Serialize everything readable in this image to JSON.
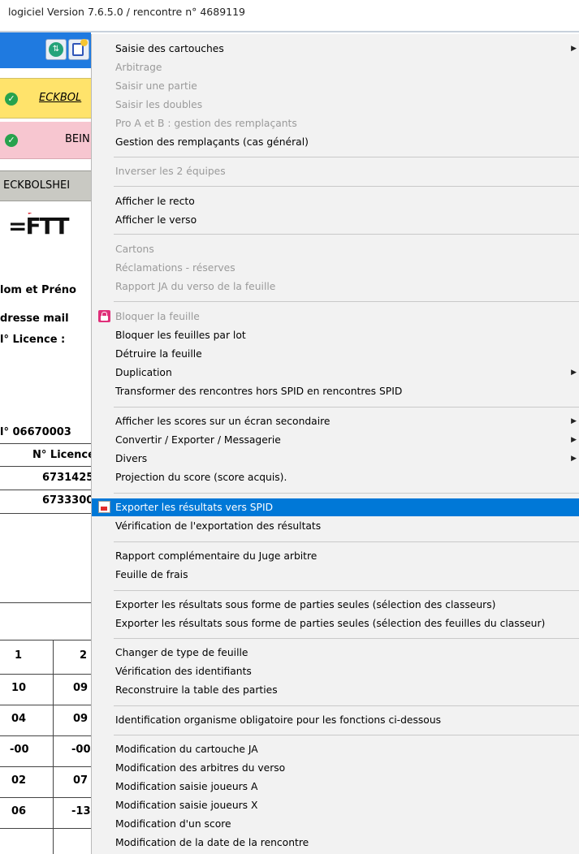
{
  "window": {
    "title": "logiciel Version 7.6.5.0  /  rencontre n° 4689119"
  },
  "background": {
    "team_a": "ECKBOL",
    "team_b": "BEIN",
    "team_row": "ECKBOLSHEI",
    "logo_text": "=FTT",
    "labels": {
      "nom_prenom": "lom et Préno",
      "adresse_mail": "dresse mail",
      "licence": "l° Licence   :"
    },
    "table": {
      "numero": "l° 06670003",
      "header": "N° Licence",
      "licences": [
        "6731425",
        "6733300"
      ]
    },
    "scores": {
      "headers": [
        "1",
        "2"
      ],
      "rows": [
        [
          "10",
          "09"
        ],
        [
          "04",
          "09"
        ],
        [
          "-00",
          "-00"
        ],
        [
          "02",
          "07"
        ],
        [
          "06",
          "-13"
        ]
      ]
    }
  },
  "menu": {
    "items": [
      {
        "label": "Saisie des cartouches",
        "disabled": false,
        "submenu": true
      },
      {
        "label": "Arbitrage",
        "disabled": true
      },
      {
        "label": "Saisir une partie",
        "disabled": true
      },
      {
        "label": "Saisir les doubles",
        "disabled": true
      },
      {
        "label": "Pro A et B : gestion des remplaçants",
        "disabled": true
      },
      {
        "label": "Gestion des remplaçants (cas général)",
        "disabled": false
      },
      {
        "label": "Inverser les 2 équipes",
        "disabled": true
      },
      {
        "label": "Afficher le recto",
        "disabled": false
      },
      {
        "label": "Afficher le verso",
        "disabled": false
      },
      {
        "label": "Cartons",
        "disabled": true
      },
      {
        "label": "Réclamations - réserves",
        "disabled": true
      },
      {
        "label": "Rapport JA du verso de la feuille",
        "disabled": true
      },
      {
        "label": "Bloquer la feuille",
        "disabled": true,
        "icon": "lock-icon"
      },
      {
        "label": "Bloquer les feuilles par lot",
        "disabled": false
      },
      {
        "label": "Détruire la feuille",
        "disabled": false
      },
      {
        "label": "Duplication",
        "disabled": false,
        "submenu": true
      },
      {
        "label": "Transformer des rencontres hors SPID en rencontres SPID",
        "disabled": false
      },
      {
        "label": "Afficher les scores sur un écran secondaire",
        "disabled": false,
        "submenu": true
      },
      {
        "label": "Convertir / Exporter / Messagerie",
        "disabled": false,
        "submenu": true
      },
      {
        "label": "Divers",
        "disabled": false,
        "submenu": true
      },
      {
        "label": "Projection du score (score acquis).",
        "disabled": false
      },
      {
        "label": "Exporter les résultats vers SPID",
        "disabled": false,
        "selected": true,
        "icon": "export-icon"
      },
      {
        "label": "Vérification de l'exportation des résultats",
        "disabled": false
      },
      {
        "label": "Rapport complémentaire du Juge arbitre",
        "disabled": false
      },
      {
        "label": "Feuille de frais",
        "disabled": false
      },
      {
        "label": "Exporter les résultats sous forme de parties seules (sélection des classeurs)",
        "disabled": false
      },
      {
        "label": "Exporter les résultats sous forme de parties seules (sélection des feuilles du classeur)",
        "disabled": false
      },
      {
        "label": "Changer de type de feuille",
        "disabled": false
      },
      {
        "label": "Vérification des identifiants",
        "disabled": false
      },
      {
        "label": "Reconstruire la table des parties",
        "disabled": false
      },
      {
        "label": "Identification organisme obligatoire pour les fonctions ci-dessous",
        "disabled": false
      },
      {
        "label": "Modification du cartouche JA",
        "disabled": false
      },
      {
        "label": "Modification des arbitres du verso",
        "disabled": false
      },
      {
        "label": "Modification saisie joueurs A",
        "disabled": false
      },
      {
        "label": "Modification saisie joueurs X",
        "disabled": false
      },
      {
        "label": "Modification d'un score",
        "disabled": false
      },
      {
        "label": "Modification de la date de la rencontre",
        "disabled": false
      }
    ]
  }
}
